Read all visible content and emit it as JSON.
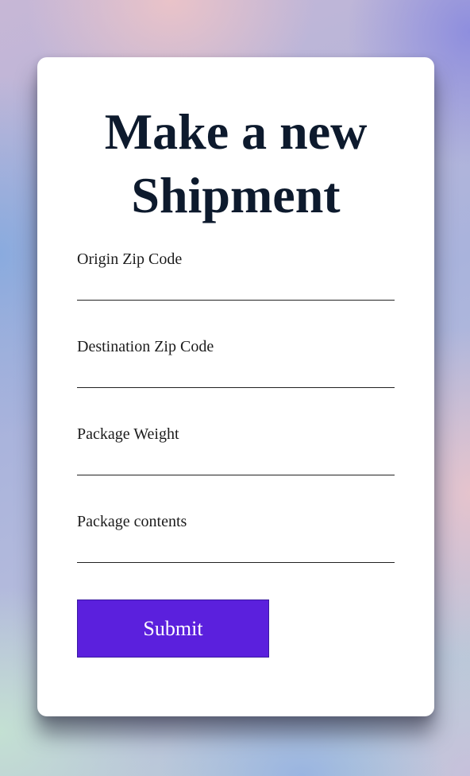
{
  "form": {
    "title": "Make a new Shipment",
    "fields": [
      {
        "label": "Origin Zip Code",
        "value": ""
      },
      {
        "label": "Destination Zip Code",
        "value": ""
      },
      {
        "label": "Package Weight",
        "value": ""
      },
      {
        "label": "Package contents",
        "value": ""
      }
    ],
    "submit_label": "Submit"
  },
  "colors": {
    "card_background": "#ffffff",
    "title_text": "#0d1a2d",
    "button_background": "#5b20dd",
    "button_text": "#ffffff"
  }
}
